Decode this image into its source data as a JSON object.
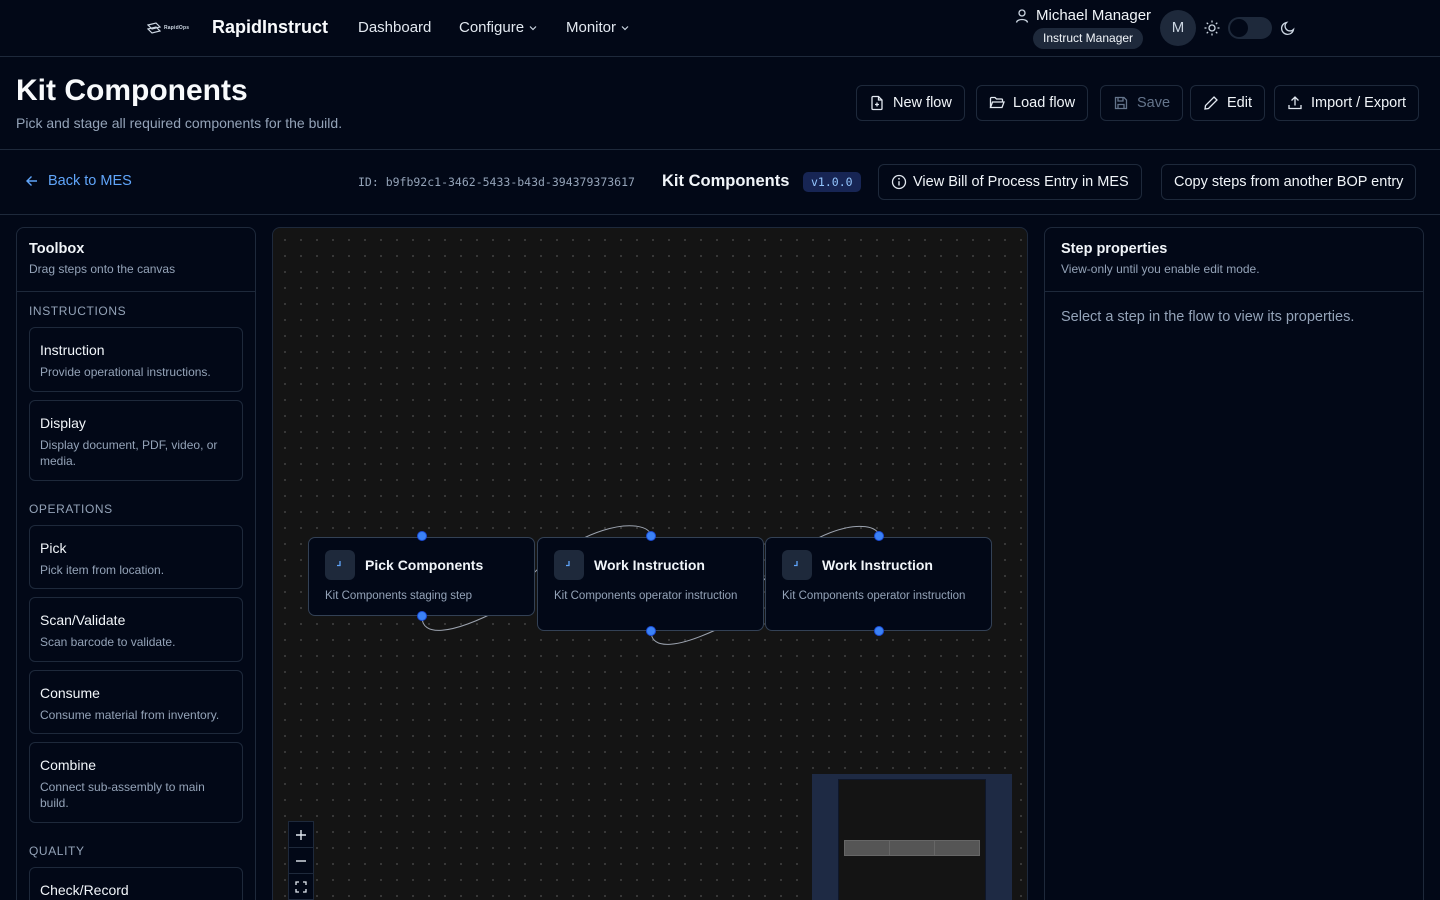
{
  "app": {
    "logo_text": "RapidOps",
    "brand": "RapidInstruct",
    "nav": [
      {
        "label": "Dashboard"
      },
      {
        "label": "Configure"
      },
      {
        "label": "Monitor"
      }
    ],
    "user": {
      "name": "Michael Manager",
      "role": "Instruct Manager",
      "initial": "M"
    }
  },
  "header": {
    "title": "Kit Components",
    "subtitle": "Pick and stage all required components for the build.",
    "buttons": {
      "new_flow": "New flow",
      "load_flow": "Load flow",
      "save": "Save",
      "edit": "Edit",
      "import_export": "Import / Export"
    }
  },
  "flowbar": {
    "back": "Back to MES",
    "id": "ID: b9fb92c1-3462-5433-b43d-394379373617",
    "name": "Kit Components",
    "version": "v1.0.0",
    "view_bop": "View Bill of Process Entry in MES",
    "copy_steps": "Copy steps from another BOP entry"
  },
  "toolbox": {
    "title": "Toolbox",
    "subtitle": "Drag steps onto the canvas",
    "sections": [
      {
        "label": "INSTRUCTIONS",
        "items": [
          {
            "name": "Instruction",
            "desc": "Provide operational instructions."
          },
          {
            "name": "Display",
            "desc": "Display document, PDF, video, or media."
          }
        ]
      },
      {
        "label": "OPERATIONS",
        "items": [
          {
            "name": "Pick",
            "desc": "Pick item from location."
          },
          {
            "name": "Scan/Validate",
            "desc": "Scan barcode to validate."
          },
          {
            "name": "Consume",
            "desc": "Consume material from inventory."
          },
          {
            "name": "Combine",
            "desc": "Connect sub-assembly to main build."
          }
        ]
      },
      {
        "label": "QUALITY",
        "items": [
          {
            "name": "Check/Record",
            "desc": ""
          }
        ]
      }
    ]
  },
  "canvas": {
    "nodes": [
      {
        "title": "Pick Components",
        "desc": "Kit Components staging step"
      },
      {
        "title": "Work Instruction",
        "desc": "Kit Components operator instruction"
      },
      {
        "title": "Work Instruction",
        "desc": "Kit Components operator instruction"
      }
    ]
  },
  "properties": {
    "title": "Step properties",
    "subtitle": "View-only until you enable edit mode.",
    "empty": "Select a step in the flow to view its properties."
  },
  "colors": {
    "background": "#020817",
    "border": "#1e293b",
    "accent": "#3b82f6",
    "link": "#60a5fa",
    "canvas": "#141414"
  },
  "icons": [
    "logo-icon",
    "chevron-down-icon",
    "user-icon",
    "sun-icon",
    "moon-icon",
    "file-plus-icon",
    "folder-open-icon",
    "save-icon",
    "pencil-icon",
    "upload-icon",
    "arrow-left-icon",
    "info-icon",
    "clock-icon",
    "plus-icon",
    "minus-icon",
    "fit-view-icon"
  ]
}
